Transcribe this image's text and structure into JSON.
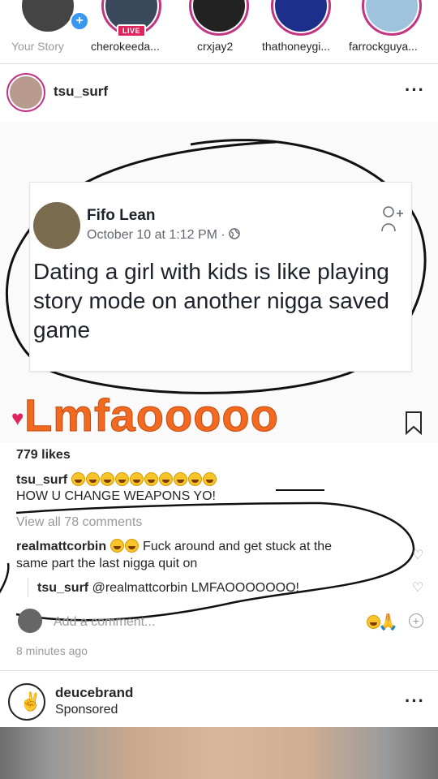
{
  "stories": [
    {
      "name": "Your Story",
      "ring": false
    },
    {
      "name": "cherokeeda...",
      "live_badge": "LIVE"
    },
    {
      "name": "crxjay2"
    },
    {
      "name": "thathoneygi..."
    },
    {
      "name": "farrockguya..."
    }
  ],
  "post": {
    "username": "tsu_surf",
    "more_icon": "more-dots-icon",
    "quoted_post": {
      "author": "Fifo Lean",
      "date": "October 10 at 1:12 PM · ",
      "globe_icon": "globe-icon",
      "text": "Dating a girl with kids is like playing story mode on another nigga saved game"
    },
    "overlay_text": "Lmfaooooo",
    "likes": "779 likes",
    "caption": {
      "username": "tsu_surf",
      "line2": "HOW U CHANGE WEAPONS YO!"
    },
    "view_all": "View all 78 comments",
    "comments": [
      {
        "username": "realmattcorbin",
        "text": " Fuck around and get stuck at the",
        "text2": "same part the last nigga quit on"
      },
      {
        "username": "tsu_surf",
        "text": "@realmattcorbin LMFAOOOOOOO!"
      }
    ],
    "add_comment_placeholder": "Add a comment...",
    "time_ago": "8 minutes ago"
  },
  "next_post": {
    "username": "deucebrand",
    "sublabel": "Sponsored"
  },
  "colors": {
    "accent": "#f26a21",
    "ring": "#c13584",
    "link": "#3897f0"
  }
}
